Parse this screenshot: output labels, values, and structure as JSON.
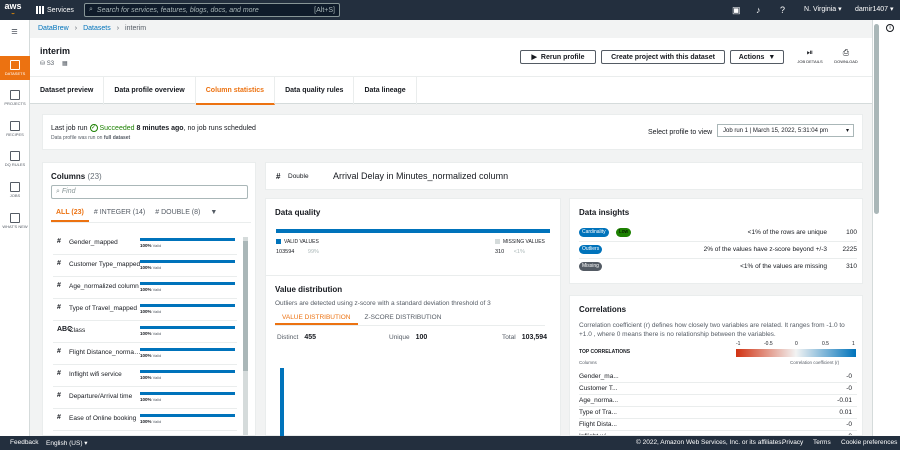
{
  "topbar": {
    "logo": "aws",
    "services": "Services",
    "search_placeholder": "Search for services, features, blogs, docs, and more",
    "search_shortcut": "[Alt+S]",
    "region": "N. Virginia ▾",
    "user": "damir1407 ▾"
  },
  "nav": {
    "items": [
      {
        "label": "DATASETS"
      },
      {
        "label": "PROJECTS"
      },
      {
        "label": "RECIPES"
      },
      {
        "label": "DQ RULES"
      },
      {
        "label": "JOBS"
      },
      {
        "label": "WHAT'S NEW"
      }
    ]
  },
  "breadcrumb": {
    "root": "DataBrew",
    "datasets": "Datasets",
    "current": "interim"
  },
  "header": {
    "name": "interim",
    "s3": "S3",
    "rerun": "Rerun profile",
    "create": "Create project with this dataset",
    "actions": "Actions",
    "job_details": "JOB DETAILS",
    "download": "DOWNLOAD"
  },
  "tabs": [
    "Dataset preview",
    "Data profile overview",
    "Column statistics",
    "Data quality rules",
    "Data lineage"
  ],
  "jobrun": {
    "prefix": "Last job run",
    "status": "Succeeded",
    "when": "8 minutes ago",
    "suffix": ", no job runs scheduled",
    "note_prefix": "Data profile was run on",
    "note_bold": "full dataset",
    "select_label": "Select profile to view",
    "selected": "Job run 1 | March 15, 2022, 5:31:04 pm"
  },
  "columns": {
    "title": "Columns",
    "count": "(23)",
    "filter_placeholder": "Find",
    "filter_tabs": [
      "ALL (23)",
      "# INTEGER (14)",
      "# DOUBLE (8)"
    ],
    "rows": [
      {
        "icon": "#",
        "name": "Gender_mapped",
        "pct": "100%",
        "label": "Valid",
        "valid": 1.0
      },
      {
        "icon": "#",
        "name": "Customer Type_mapped",
        "pct": "100%",
        "label": "Valid",
        "valid": 1.0
      },
      {
        "icon": "#",
        "name": "Age_normalized column",
        "pct": "100%",
        "label": "Valid",
        "valid": 1.0
      },
      {
        "icon": "#",
        "name": "Type of Travel_mapped",
        "pct": "100%",
        "label": "Valid",
        "valid": 1.0
      },
      {
        "icon": "ABC",
        "name": "Class",
        "pct": "100%",
        "label": "Valid",
        "valid": 1.0
      },
      {
        "icon": "#",
        "name": "Flight Distance_normalized",
        "pct": "100%",
        "label": "Valid",
        "valid": 1.0
      },
      {
        "icon": "#",
        "name": "Inflight wifi service",
        "pct": "100%",
        "label": "Valid",
        "valid": 1.0
      },
      {
        "icon": "#",
        "name": "Departure/Arrival time",
        "pct": "100%",
        "label": "Valid",
        "valid": 1.0
      },
      {
        "icon": "#",
        "name": "Ease of Online booking",
        "pct": "100%",
        "label": "Valid",
        "valid": 1.0
      }
    ]
  },
  "column_header": {
    "type": "Double",
    "name": "Arrival Delay in Minutes_normalized column"
  },
  "data_quality": {
    "title": "Data quality",
    "valid_label": "VALID VALUES",
    "missing_label": "MISSING VALUES",
    "valid_count": "103594",
    "valid_pct": "99%",
    "missing_count": "310",
    "missing_pct": "<1%",
    "valid_fraction": 0.997
  },
  "value_distribution": {
    "title": "Value distribution",
    "desc": "Outliers are detected using z-score with a standard deviation threshold of 3",
    "tabs": [
      "VALUE DISTRIBUTION",
      "Z-SCORE DISTRIBUTION"
    ],
    "distinct_label": "Distinct",
    "distinct": "455",
    "unique_label": "Unique",
    "unique": "100",
    "total_label": "Total",
    "total": "103,594"
  },
  "insights": {
    "title": "Data insights",
    "rows": [
      {
        "tag": "Cardinality",
        "badge": "Low",
        "text": "<1% of the rows are unique",
        "value": "100"
      },
      {
        "tag": "Outliers",
        "badge": "",
        "text": "2% of the values have z-score beyond +/-3",
        "value": "2225"
      },
      {
        "tag": "Missing",
        "badge": "",
        "text": "<1% of the values are missing",
        "value": "310"
      }
    ]
  },
  "correlations": {
    "title": "Correlations",
    "desc": "Correlation coefficient (r) defines how closely two variables are related. It ranges from -1.0 to +1.0 , where 0 means there is no relationship between the variables.",
    "head": "TOP CORRELATIONS",
    "col_label": "Columns",
    "coef_label": "Correlation coefficient (r)",
    "scale": [
      "-1",
      "-0.5",
      "0",
      "0.5",
      "1"
    ],
    "rows": [
      {
        "name": "Gender_ma...",
        "value": "-0"
      },
      {
        "name": "Customer T...",
        "value": "-0"
      },
      {
        "name": "Age_norma...",
        "value": "-0.01"
      },
      {
        "name": "Type of Tra...",
        "value": "0.01"
      },
      {
        "name": "Flight Dista...",
        "value": "-0"
      },
      {
        "name": "Inflight wi...",
        "value": "-0"
      }
    ]
  },
  "footer": {
    "feedback": "Feedback",
    "lang": "English (US) ▾",
    "copyright": "© 2022, Amazon Web Services, Inc. or its affiliates.",
    "privacy": "Privacy",
    "terms": "Terms",
    "cookies": "Cookie preferences"
  }
}
